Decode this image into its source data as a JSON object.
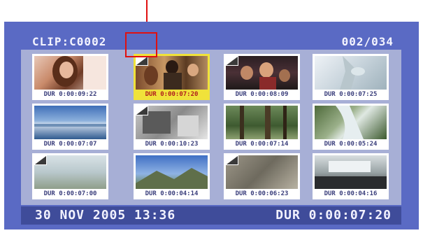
{
  "header": {
    "clip_title": "CLIP:C0002",
    "counter": "002/034"
  },
  "thumbnails": [
    {
      "dur": "DUR 0:00:09:22",
      "selected": false,
      "marker": false,
      "scene": "portrait"
    },
    {
      "dur": "DUR 0:00:07:20",
      "selected": true,
      "marker": true,
      "scene": "group"
    },
    {
      "dur": "DUR 0:00:08:09",
      "selected": false,
      "marker": true,
      "scene": "crowd"
    },
    {
      "dur": "DUR 0:00:07:25",
      "selected": false,
      "marker": false,
      "scene": "bright"
    },
    {
      "dur": "DUR 0:00:07:07",
      "selected": false,
      "marker": false,
      "scene": "sea"
    },
    {
      "dur": "DUR 0:00:10:23",
      "selected": false,
      "marker": true,
      "scene": "room"
    },
    {
      "dur": "DUR 0:00:07:14",
      "selected": false,
      "marker": false,
      "scene": "forest"
    },
    {
      "dur": "DUR 0:00:05:24",
      "selected": false,
      "marker": false,
      "scene": "stream"
    },
    {
      "dur": "DUR 0:00:07:00",
      "selected": false,
      "marker": true,
      "scene": "sky"
    },
    {
      "dur": "DUR 0:00:04:14",
      "selected": false,
      "marker": false,
      "scene": "mountain"
    },
    {
      "dur": "DUR 0:00:06:23",
      "selected": false,
      "marker": true,
      "scene": "ground"
    },
    {
      "dur": "DUR 0:00:04:16",
      "selected": false,
      "marker": false,
      "scene": "car"
    }
  ],
  "status": {
    "datetime": "30 NOV 2005 13:36",
    "dur_total": "DUR  0:00:07:20"
  },
  "colors": {
    "screen_bg": "#5a6ac4",
    "grid_bg": "#a7afd6",
    "selection": "#f0e23a",
    "callout": "#e01010",
    "status_bg": "#3f4c9a"
  }
}
